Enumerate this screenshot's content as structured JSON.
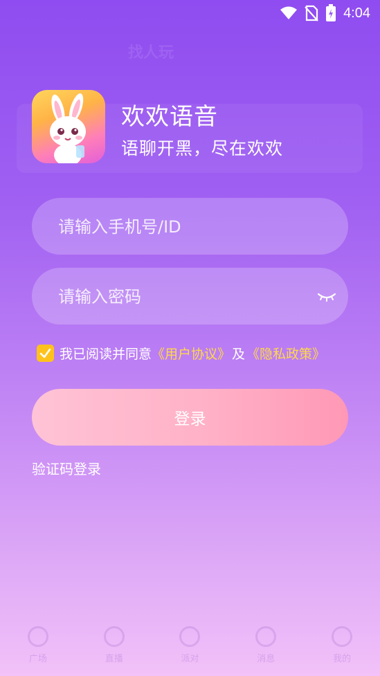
{
  "status_bar": {
    "time": "4:04"
  },
  "app": {
    "name": "欢欢语音",
    "slogan": "语聊开黑，尽在欢欢"
  },
  "phone_input": {
    "placeholder": "请输入手机号/ID",
    "value": ""
  },
  "password_input": {
    "placeholder": "请输入密码",
    "value": ""
  },
  "agreement": {
    "checked": true,
    "prefix": "我已阅读并同意",
    "user_agreement": "《用户协议》",
    "and": "及",
    "privacy_policy": "《隐私政策》"
  },
  "login_button": "登录",
  "sms_login": "验证码登录",
  "colors": {
    "accent_yellow": "#ffd84a",
    "checkbox": "#ffc21c",
    "login_pink": "#ffb1c7"
  },
  "background_app": {
    "title": "找人玩",
    "nav": [
      "广场",
      "直播",
      "派对",
      "消息",
      "我的"
    ]
  }
}
